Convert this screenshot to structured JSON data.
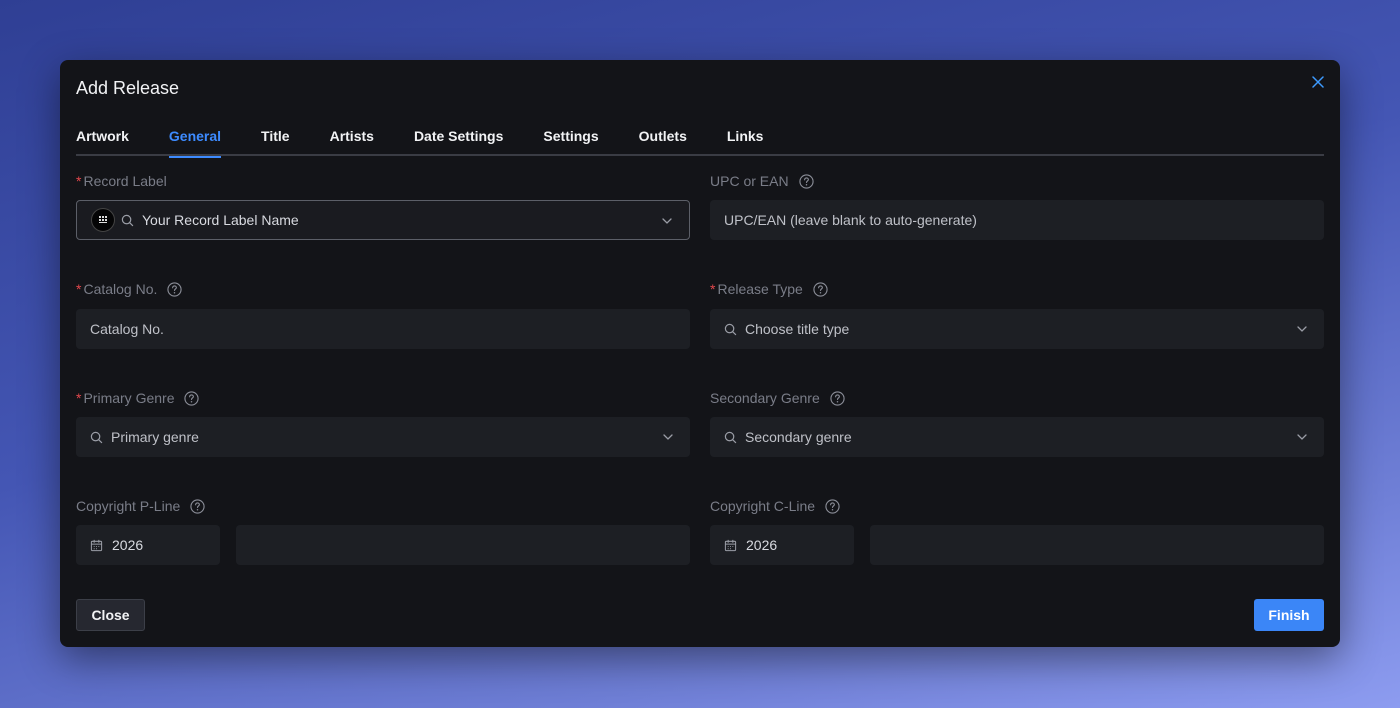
{
  "dialog": {
    "title": "Add Release"
  },
  "tabs": [
    {
      "label": "Artwork",
      "active": false
    },
    {
      "label": "General",
      "active": true
    },
    {
      "label": "Title",
      "active": false
    },
    {
      "label": "Artists",
      "active": false
    },
    {
      "label": "Date Settings",
      "active": false
    },
    {
      "label": "Settings",
      "active": false
    },
    {
      "label": "Outlets",
      "active": false
    },
    {
      "label": "Links",
      "active": false
    }
  ],
  "fields": {
    "record_label": {
      "label": "Record Label",
      "required": "*",
      "value": "Your Record Label Name"
    },
    "upc": {
      "label": "UPC or EAN",
      "placeholder": "UPC/EAN (leave blank to auto-generate)"
    },
    "catalog": {
      "label": "Catalog No.",
      "required": "*",
      "placeholder": "Catalog No."
    },
    "release_type": {
      "label": "Release Type",
      "required": "*",
      "placeholder": "Choose title type"
    },
    "primary_genre": {
      "label": "Primary Genre",
      "required": "*",
      "placeholder": "Primary genre"
    },
    "secondary_genre": {
      "label": "Secondary Genre",
      "placeholder": "Secondary genre"
    },
    "p_line": {
      "label": "Copyright P-Line",
      "year": "2026",
      "text": ""
    },
    "c_line": {
      "label": "Copyright C-Line",
      "year": "2026",
      "text": ""
    }
  },
  "footer": {
    "close_label": "Close",
    "finish_label": "Finish"
  },
  "colors": {
    "accent": "#3d8bff",
    "required": "#e5484d",
    "modal_bg": "#131418",
    "input_bg": "#1d1f24"
  },
  "icons": [
    "close-icon",
    "search-icon",
    "chevron-down-icon",
    "help-icon",
    "calendar-icon",
    "label-logo-icon"
  ]
}
